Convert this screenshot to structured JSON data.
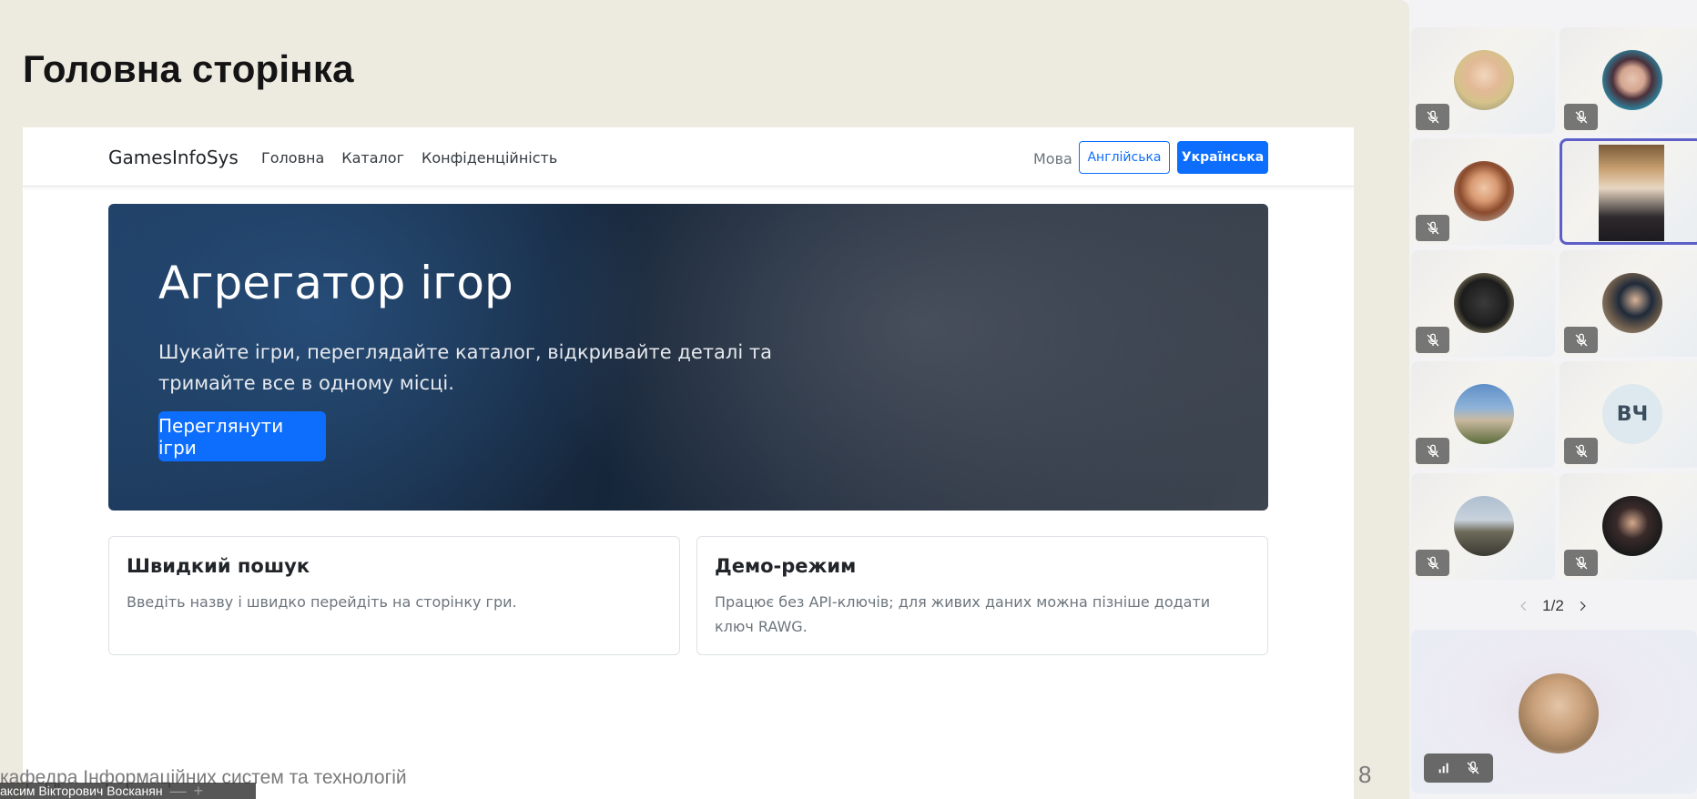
{
  "slide": {
    "title": "Головна сторінка",
    "footer": "кафедра Інформаційних систем та технологій",
    "number": "8",
    "speaker_name": "аксим Вікторович Восканян",
    "speaker_minimize": "—",
    "speaker_expand": "+"
  },
  "website": {
    "brand": "GamesInfoSys",
    "nav": [
      "Головна",
      "Каталог",
      "Конфіденційність"
    ],
    "language_label": "Мова",
    "language_english": "Англійська",
    "language_ukrainian": "Українська",
    "hero_title": "Агрегатор ігор",
    "hero_text": "Шукайте ігри, переглядайте каталог, відкривайте деталі та тримайте все в одному місці.",
    "hero_button": "Переглянути ігри",
    "cards": [
      {
        "title": "Швидкий пошук",
        "text": "Введіть назву і швидко перейдіть на сторінку гри."
      },
      {
        "title": "Демо-режим",
        "text": "Працює без API-ключів; для живих даних можна пізніше додати ключ RAWG."
      }
    ]
  },
  "participants": {
    "tiles": [
      {
        "avatar": "photo",
        "muted": true
      },
      {
        "avatar": "photo",
        "muted": true
      },
      {
        "avatar": "photo",
        "muted": true
      },
      {
        "avatar": "video",
        "muted": false,
        "selected": true
      },
      {
        "avatar": "photo",
        "muted": true
      },
      {
        "avatar": "photo",
        "muted": true
      },
      {
        "avatar": "photo",
        "muted": true
      },
      {
        "avatar": "initials",
        "initials": "ВЧ",
        "muted": true
      },
      {
        "avatar": "photo",
        "muted": true
      },
      {
        "avatar": "photo",
        "muted": true
      }
    ],
    "page_indicator": "1/2",
    "icons": {
      "mute": "mic-off-icon",
      "signal": "signal-bars-icon",
      "prev": "chevron-left-icon",
      "next": "chevron-right-icon"
    },
    "accent_color": "#5b5fc7"
  }
}
